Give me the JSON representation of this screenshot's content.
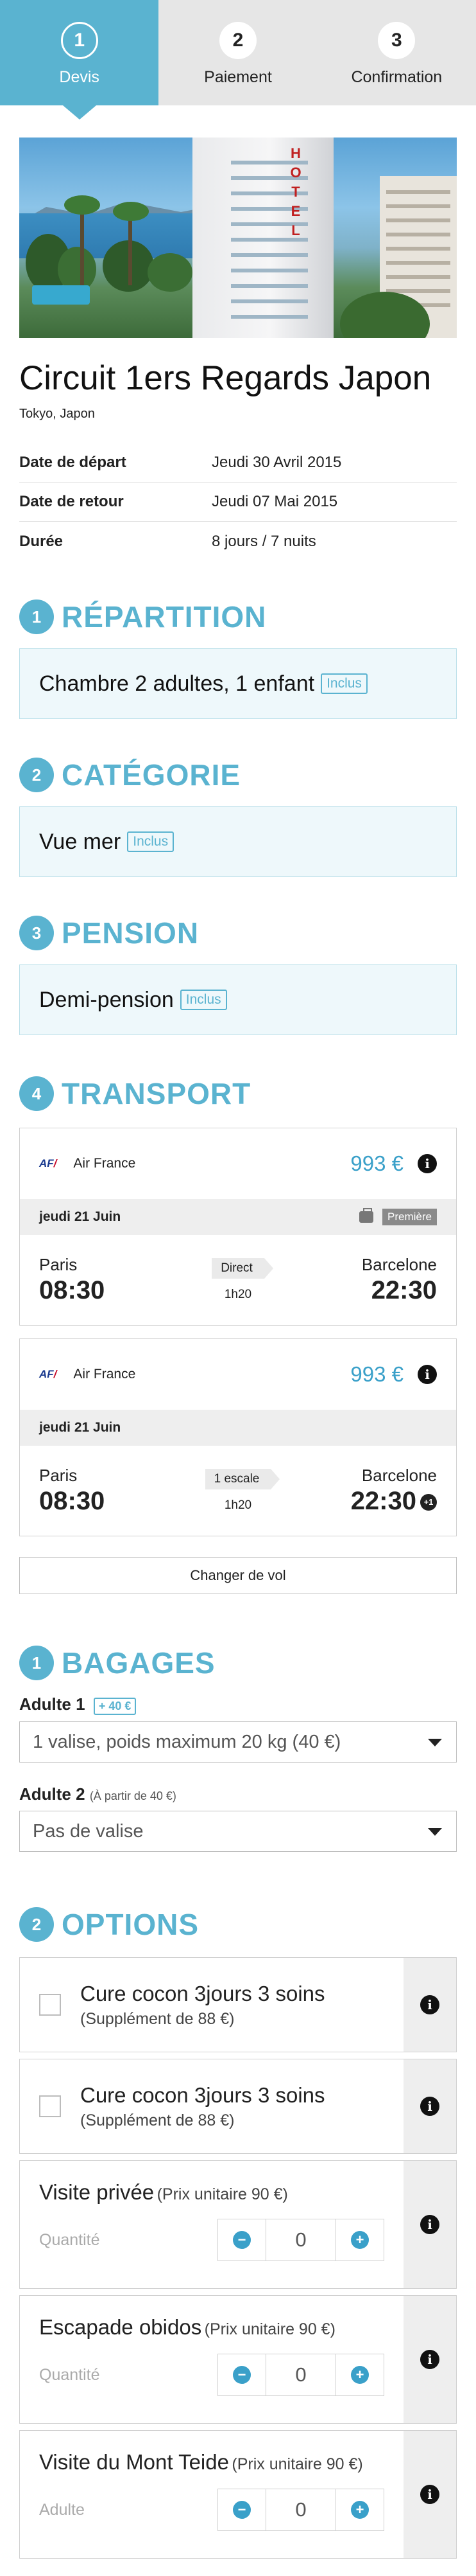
{
  "steps": [
    {
      "num": "1",
      "label": "Devis"
    },
    {
      "num": "2",
      "label": "Paiement"
    },
    {
      "num": "3",
      "label": "Confirmation"
    }
  ],
  "hotel_sign": "HOTEL",
  "tour": {
    "title": "Circuit 1ers Regards Japon",
    "location": "Tokyo, Japon"
  },
  "info": [
    {
      "key": "Date de départ",
      "value": "Jeudi 30 Avril 2015"
    },
    {
      "key": "Date de retour",
      "value": "Jeudi 07 Mai 2015"
    },
    {
      "key": "Durée",
      "value": "8 jours / 7 nuits"
    }
  ],
  "repartition": {
    "num": "1",
    "title": "RÉPARTITION",
    "text": "Chambre 2 adultes, 1 enfant",
    "tag": "Inclus"
  },
  "categorie": {
    "num": "2",
    "title": "CATÉGORIE",
    "text": "Vue mer",
    "tag": "Inclus"
  },
  "pension": {
    "num": "3",
    "title": "PENSION",
    "text": "Demi-pension",
    "tag": "Inclus"
  },
  "transport": {
    "num": "4",
    "title": "TRANSPORT",
    "flights": [
      {
        "logo": "AF",
        "airline": "Air France",
        "price": "993 €",
        "day": "jeudi 21 Juin",
        "cabin": "Première",
        "from_city": "Paris",
        "from_time": "08:30",
        "stop": "Direct",
        "duration": "1h20",
        "to_city": "Barcelone",
        "to_time": "22:30",
        "plus": ""
      },
      {
        "logo": "AF",
        "airline": "Air France",
        "price": "993 €",
        "day": "jeudi 21 Juin",
        "cabin": "",
        "from_city": "Paris",
        "from_time": "08:30",
        "stop": "1 escale",
        "duration": "1h20",
        "to_city": "Barcelone",
        "to_time": "22:30",
        "plus": "+1"
      }
    ],
    "change_label": "Changer de vol"
  },
  "bagages": {
    "num": "1",
    "title": "BAGAGES",
    "adult1_label": "Adulte 1",
    "adult1_tag": "+ 40 €",
    "adult1_select": "1 valise, poids maximum 20 kg (40 €)",
    "adult2_label": "Adulte 2",
    "adult2_note": "(À partir de 40 €)",
    "adult2_select": "Pas de valise"
  },
  "options": {
    "num": "2",
    "title": "OPTIONS",
    "checkbox_items": [
      {
        "title": "Cure cocon 3jours 3 soins",
        "sub": "(Supplément de 88 €)"
      },
      {
        "title": "Cure cocon 3jours 3 soins",
        "sub": "(Supplément de 88 €)"
      }
    ],
    "qty_items": [
      {
        "title": "Visite privée",
        "unit": "(Prix unitaire 90 €)",
        "qty_label": "Quantité",
        "value": "0"
      },
      {
        "title": "Escapade obidos",
        "unit": "(Prix unitaire 90 €)",
        "qty_label": "Quantité",
        "value": "0"
      },
      {
        "title": "Visite du Mont Teide",
        "unit": "(Prix unitaire 90 €)",
        "qty_label": "Adulte",
        "value": "0"
      }
    ],
    "minus": "−",
    "plus": "+"
  },
  "icons": {
    "info": "i"
  },
  "colors": {
    "accent": "#5ab3d0",
    "price": "#3aa0c9",
    "stepper_bg": "#e6e6e6"
  }
}
